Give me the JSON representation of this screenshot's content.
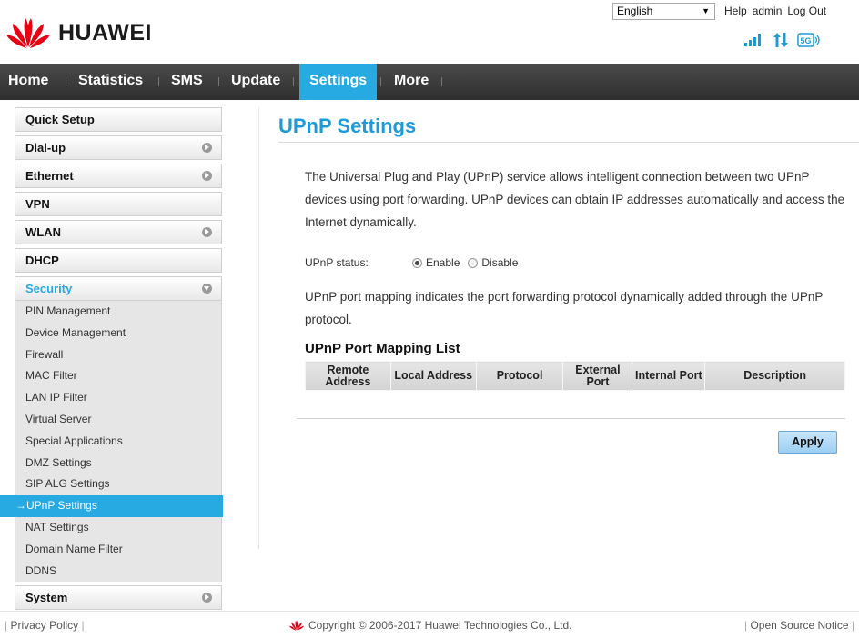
{
  "header": {
    "brand": "HUAWEI",
    "language": "English",
    "help": "Help",
    "user": "admin",
    "logout": "Log Out",
    "network_badge": "5G"
  },
  "nav": {
    "items": [
      "Home",
      "Statistics",
      "SMS",
      "Update",
      "Settings",
      "More"
    ],
    "active": "Settings"
  },
  "sidebar": {
    "quick_setup": "Quick Setup",
    "dialup": "Dial-up",
    "ethernet": "Ethernet",
    "vpn": "VPN",
    "wlan": "WLAN",
    "dhcp": "DHCP",
    "security": "Security",
    "security_items": [
      "PIN Management",
      "Device Management",
      "Firewall",
      "MAC Filter",
      "LAN IP Filter",
      "Virtual Server",
      "Special Applications",
      "DMZ Settings",
      "SIP ALG Settings",
      "UPnP Settings",
      "NAT Settings",
      "Domain Name Filter",
      "DDNS"
    ],
    "active_item": "→UPnP Settings",
    "system": "System"
  },
  "main": {
    "title": "UPnP Settings",
    "intro": "The Universal Plug and Play (UPnP) service allows intelligent connection between two UPnP devices using port forwarding. UPnP devices can obtain IP addresses automatically and access the Internet dynamically.",
    "status_label": "UPnP status:",
    "enable_label": "Enable",
    "disable_label": "Disable",
    "status_value": "Enable",
    "mapping_desc": "UPnP port mapping indicates the port forwarding protocol dynamically added through the UPnP protocol.",
    "list_title": "UPnP Port Mapping List",
    "table_headers": [
      "Remote Address",
      "Local Address",
      "Protocol",
      "External Port",
      "Internal Port",
      "Description"
    ],
    "apply_label": "Apply"
  },
  "footer": {
    "privacy": "Privacy Policy",
    "copyright": "Copyright © 2006-2017 Huawei Technologies Co., Ltd.",
    "open_source": "Open Source Notice"
  },
  "colors": {
    "accent": "#27a9e1",
    "nav_bg": "#3a3a3a",
    "title": "#1e9bd7",
    "logo_red": "#e60012"
  }
}
